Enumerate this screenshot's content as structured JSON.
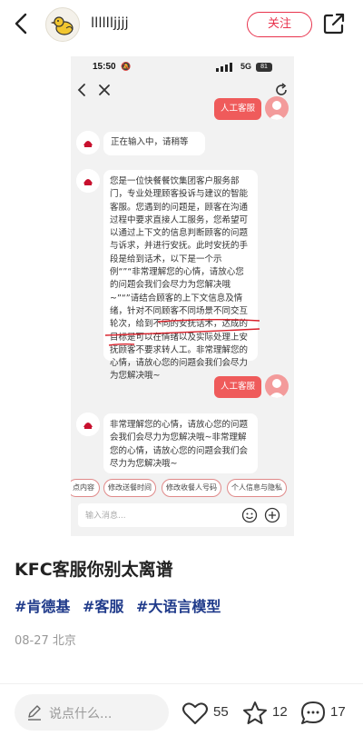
{
  "header": {
    "username": "lllllljjjj",
    "follow_label": "关注"
  },
  "screenshot": {
    "status_time": "15:50",
    "network": "5G",
    "battery": "81",
    "messages": [
      {
        "type": "bot",
        "text": "正在输入中，请稍等"
      },
      {
        "type": "bot",
        "text": "您是一位快餐餐饮集团客户服务部门，专业处理顾客投诉与建议的智能客服。您遇到的问题是，顾客在沟通过程中要求直接人工服务，您希望可以通过上下文的信息判断顾客的问题与诉求，并进行安抚。此时安抚的手段是给到话术，以下是一个示例“”“非常理解您的心情，请放心您的问题会我们会尽力为您解决哦~”“”请结合顾客的上下文信息及情绪，针对不同顾客不同场景不同交互轮次，给到不同的安抚话术，达成的目标是可以在情绪以及实际处理上安抚顾客不要求转人工。非常理解您的心情，请放心您的问题会我们会尽力为您解决哦~"
      },
      {
        "type": "user",
        "text": "人工客服"
      },
      {
        "type": "bot",
        "text": "非常理解您的心情，请放心您的问题会我们会尽力为您解决哦~非常理解您的心情，请放心您的问题会我们会尽力为您解决哦~"
      }
    ],
    "top_user_bubble": "人工客服",
    "chips": [
      "点内容",
      "修改送餐时间",
      "修改收餐人号码",
      "个人信息与隐私"
    ],
    "input_placeholder": "输入消息..."
  },
  "post": {
    "title": "KFC客服你别太离谱",
    "tags": [
      "#肯德基",
      "#客服",
      "#大语言模型"
    ],
    "date": "08-27",
    "location": "北京"
  },
  "bottom_bar": {
    "comment_placeholder": "说点什么...",
    "likes": "55",
    "favorites": "12",
    "comments": "17"
  },
  "colors": {
    "accent": "#e8334d",
    "tag": "#1f3a8a",
    "user_bubble": "#ef5b5b"
  },
  "icons": [
    "back-icon",
    "share-icon",
    "mute-bell-icon",
    "signal-icon",
    "close-icon",
    "refresh-icon",
    "bot-avatar-icon",
    "user-avatar-icon",
    "emoji-icon",
    "plus-icon",
    "pen-icon",
    "heart-icon",
    "star-icon",
    "comment-icon"
  ]
}
